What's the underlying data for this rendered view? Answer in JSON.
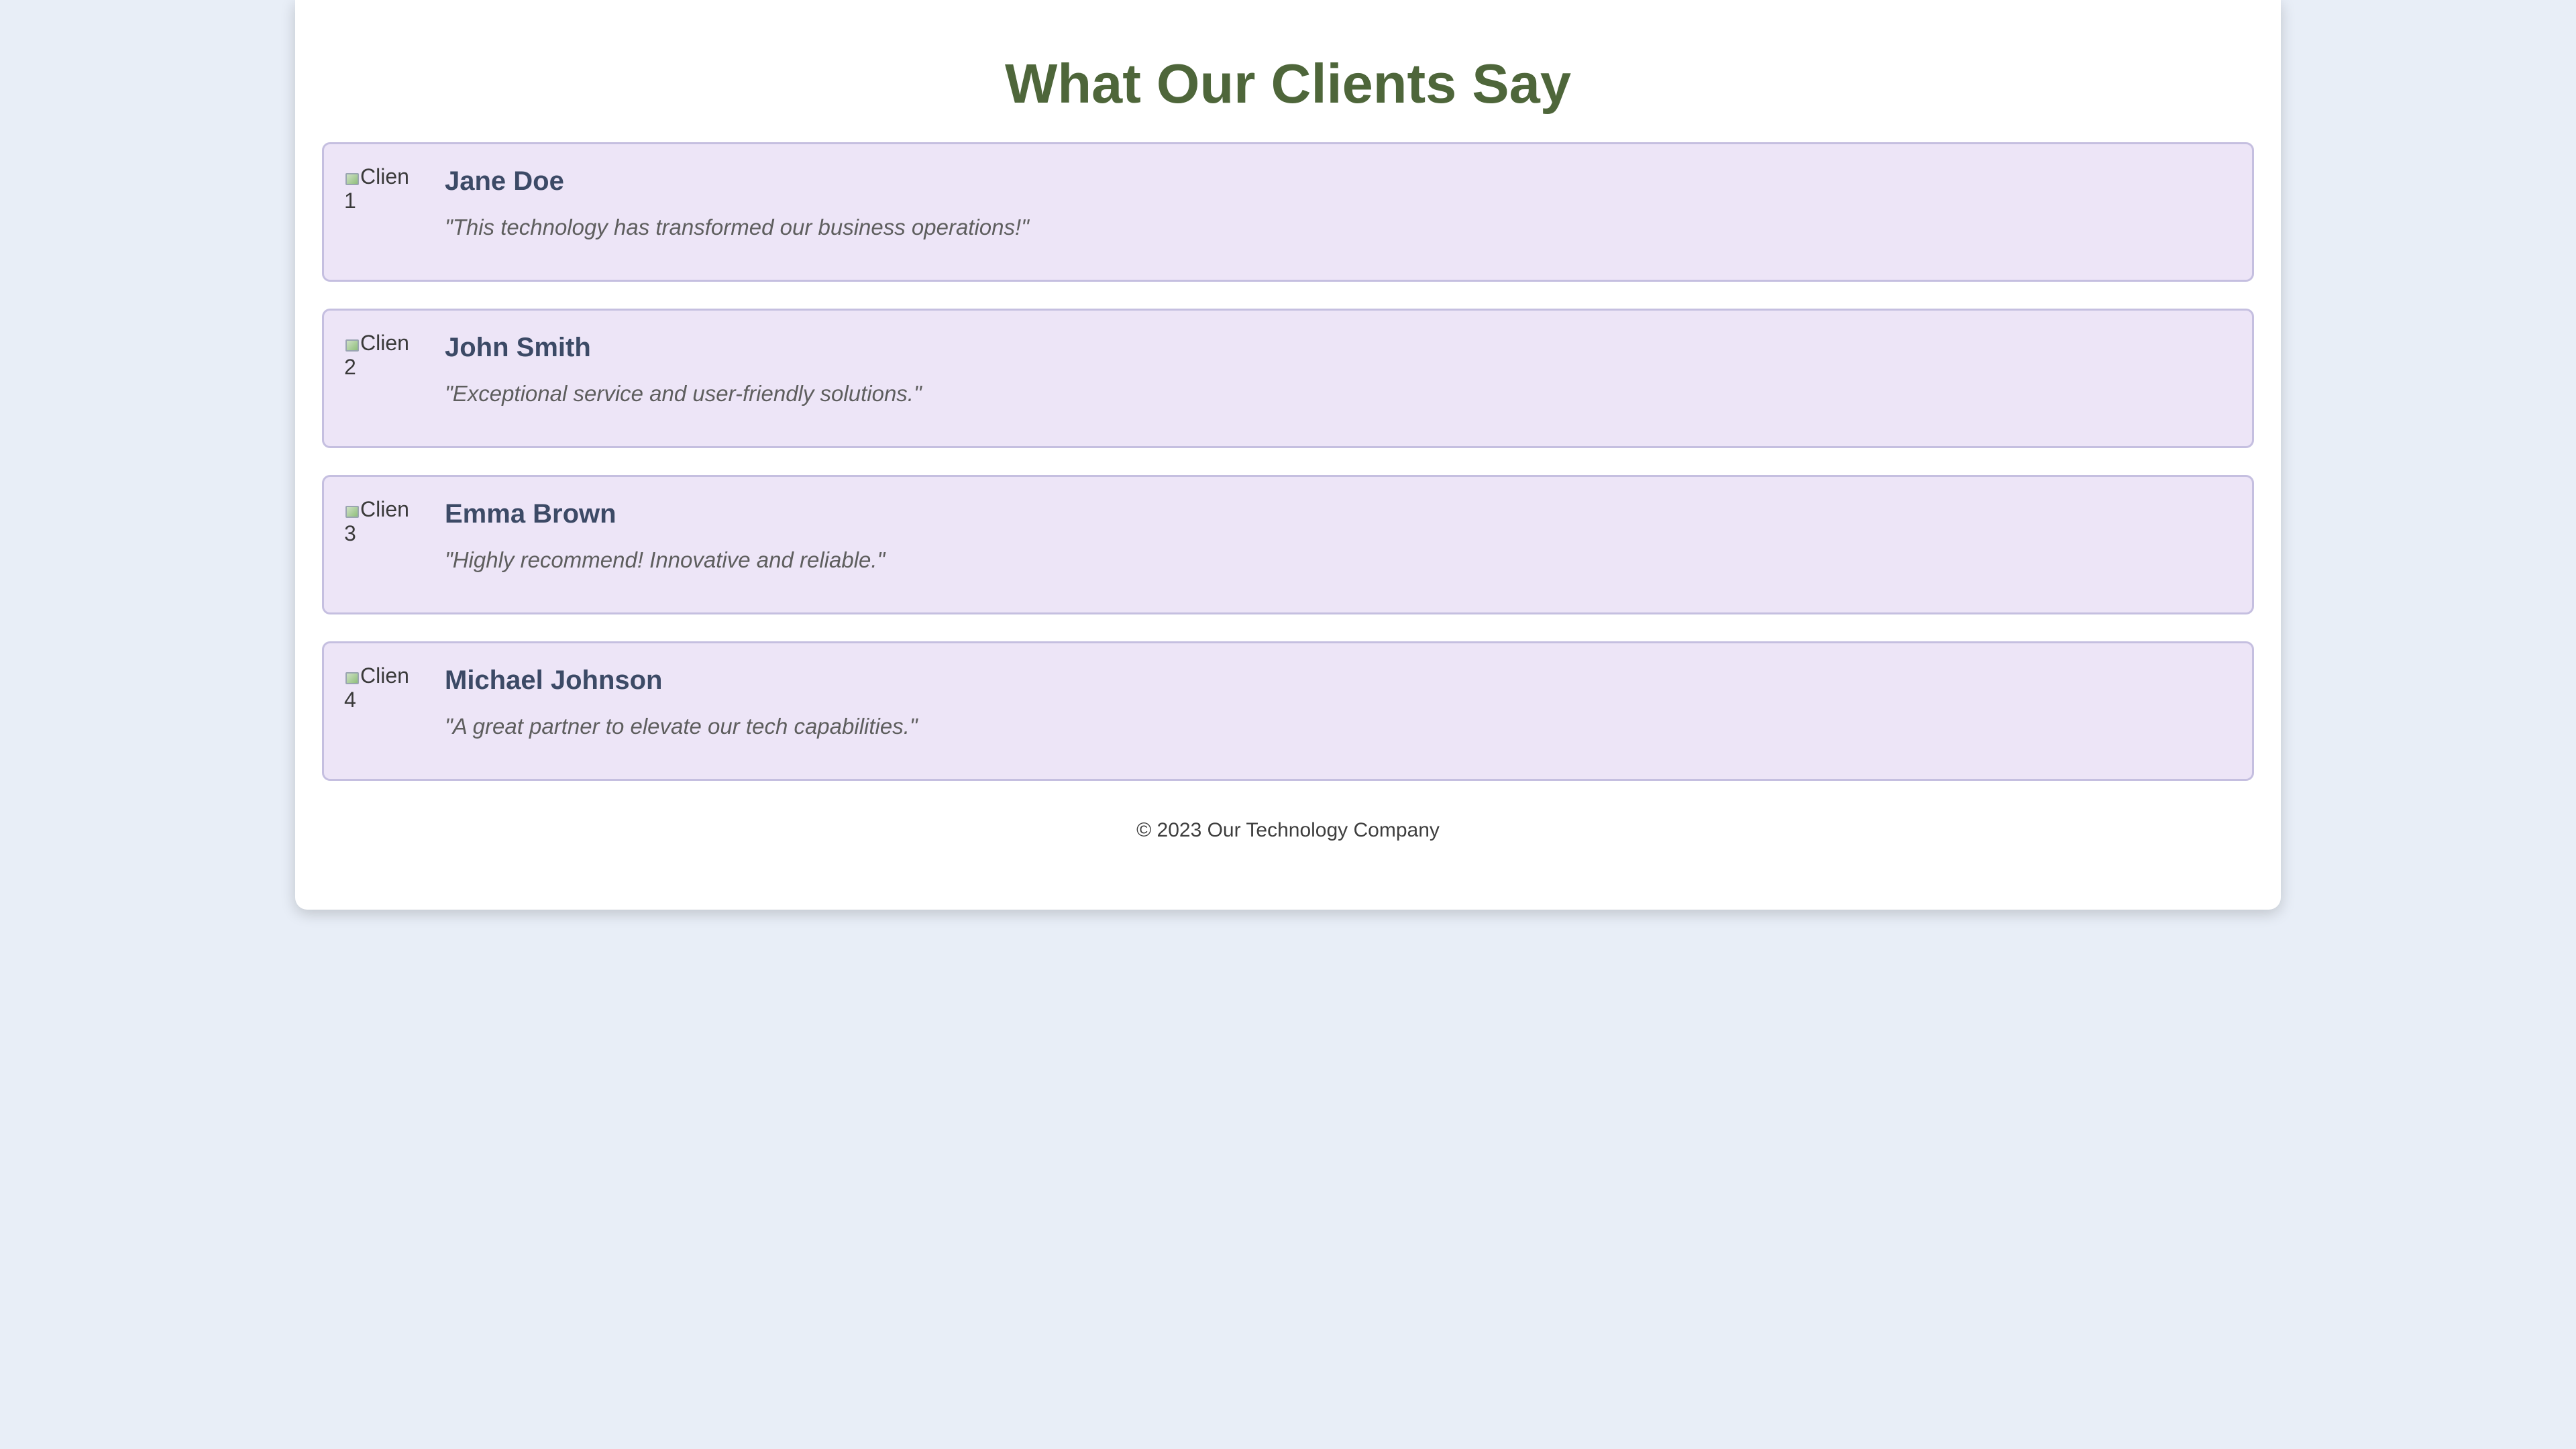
{
  "page": {
    "title": "What Our Clients Say",
    "footer": "© 2023 Our Technology Company"
  },
  "colors": {
    "background": "#e8eef7",
    "title": "#4e663a",
    "card_background": "#ede5f7",
    "card_border": "#c5bfe0",
    "name": "#3c4a66",
    "quote": "#5e5e5e"
  },
  "testimonials": [
    {
      "avatar_alt_line1": "Clien",
      "avatar_alt_line2": "1",
      "name": "Jane Doe",
      "quote": "\"This technology has transformed our business operations!\""
    },
    {
      "avatar_alt_line1": "Clien",
      "avatar_alt_line2": "2",
      "name": "John Smith",
      "quote": "\"Exceptional service and user-friendly solutions.\""
    },
    {
      "avatar_alt_line1": "Clien",
      "avatar_alt_line2": "3",
      "name": "Emma Brown",
      "quote": "\"Highly recommend! Innovative and reliable.\""
    },
    {
      "avatar_alt_line1": "Clien",
      "avatar_alt_line2": "4",
      "name": "Michael Johnson",
      "quote": "\"A great partner to elevate our tech capabilities.\""
    }
  ]
}
